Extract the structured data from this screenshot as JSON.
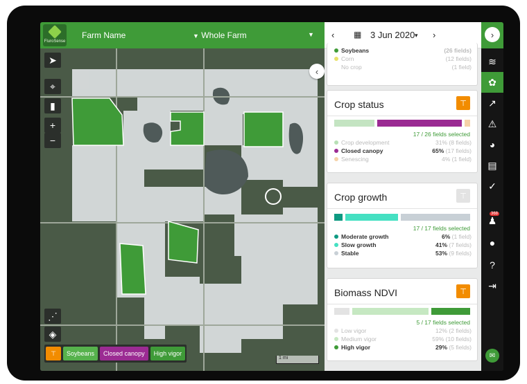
{
  "app": {
    "logo_text": "FluroSense"
  },
  "topbar": {
    "farm_name": "Farm Name",
    "farm_scope": "Whole Farm"
  },
  "date": {
    "value": "3 Jun 2020",
    "prev": "‹",
    "next": "›",
    "dropdown": "▾"
  },
  "crop_type": {
    "rows": [
      {
        "label": "Soybeans",
        "value": "(26 fields)",
        "color": "#3f9b38"
      },
      {
        "label": "Corn",
        "value": "(12 fields)",
        "color": "#e8e16a"
      },
      {
        "label": "No crop",
        "value": "(1 field)",
        "color": "#ffffff"
      }
    ]
  },
  "crop_status": {
    "title": "Crop status",
    "selected": "17 / 26 fields selected",
    "rows": [
      {
        "label": "Crop development",
        "pct": "31%",
        "count": "(8 fields)",
        "color": "#b7e0b5",
        "share": 0.31,
        "active": false
      },
      {
        "label": "Closed canopy",
        "pct": "65%",
        "count": "(17 fields)",
        "color": "#9b2b93",
        "share": 0.65,
        "active": true
      },
      {
        "label": "Senescing",
        "pct": "4%",
        "count": "(1 field)",
        "color": "#f5d2a8",
        "share": 0.04,
        "active": false
      }
    ]
  },
  "crop_growth": {
    "title": "Crop growth",
    "selected": "17 / 17 fields selected",
    "rows": [
      {
        "label": "Moderate growth",
        "pct": "6%",
        "count": "(1 field)",
        "color": "#0e9a82",
        "share": 0.06,
        "active": true
      },
      {
        "label": "Slow growth",
        "pct": "41%",
        "count": "(7 fields)",
        "color": "#45e0c2",
        "share": 0.41,
        "active": true
      },
      {
        "label": "Stable",
        "pct": "53%",
        "count": "(9 fields)",
        "color": "#c8d0d6",
        "share": 0.53,
        "active": true
      }
    ]
  },
  "biomass": {
    "title": "Biomass NDVI",
    "selected": "5 / 17 fields selected",
    "rows": [
      {
        "label": "Low vigor",
        "pct": "12%",
        "count": "(2 fields)",
        "color": "#e3e3e3",
        "share": 0.12,
        "active": false
      },
      {
        "label": "Medium vigor",
        "pct": "59%",
        "count": "(10 fields)",
        "color": "#c6e8c2",
        "share": 0.59,
        "active": false
      },
      {
        "label": "High vigor",
        "pct": "29%",
        "count": "(5 fields)",
        "color": "#3f9b38",
        "share": 0.29,
        "active": true
      }
    ]
  },
  "filters": {
    "chips": [
      {
        "label": "Soybeans",
        "color": "#56b24c"
      },
      {
        "label": "Closed canopy",
        "color": "#9b2b93"
      },
      {
        "label": "High vigor",
        "color": "#3f9b38"
      }
    ]
  },
  "map": {
    "scale_label": "1 mi"
  },
  "toolbar": {
    "notification_count": "368"
  },
  "colors": {
    "brand": "#3f9b38",
    "filter_active": "#f28c00",
    "filter_inactive": "#e3e3e3"
  }
}
